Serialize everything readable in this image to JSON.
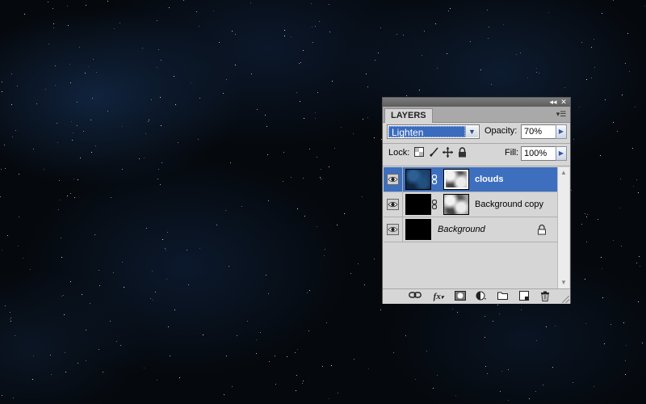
{
  "canvas": {
    "description_colors": {
      "base": "#05080c",
      "nebula": "#12284a"
    }
  },
  "panel": {
    "tab_label": "LAYERS",
    "collapse_glyph": "◂◂",
    "close_glyph": "✕",
    "menu_glyph": "▾☰",
    "blend_mode": "Lighten",
    "opacity_label": "Opacity:",
    "opacity_value": "70%",
    "lock_label": "Lock:",
    "fill_label": "Fill:",
    "fill_value": "100%",
    "accent_color": "#3d6fbe"
  },
  "layers": [
    {
      "name": "clouds",
      "selected": true,
      "visible": true,
      "has_mask": true,
      "thumb": "clouds"
    },
    {
      "name": "Background copy",
      "selected": false,
      "visible": true,
      "has_mask": true,
      "thumb": "black"
    },
    {
      "name": "Background",
      "selected": false,
      "visible": true,
      "has_mask": false,
      "thumb": "black",
      "locked": true
    }
  ],
  "bottom_toolbar": {
    "icons": [
      "link-icon",
      "fx-icon",
      "mask-icon",
      "adjustment-icon",
      "folder-icon",
      "new-layer-icon",
      "trash-icon"
    ]
  }
}
